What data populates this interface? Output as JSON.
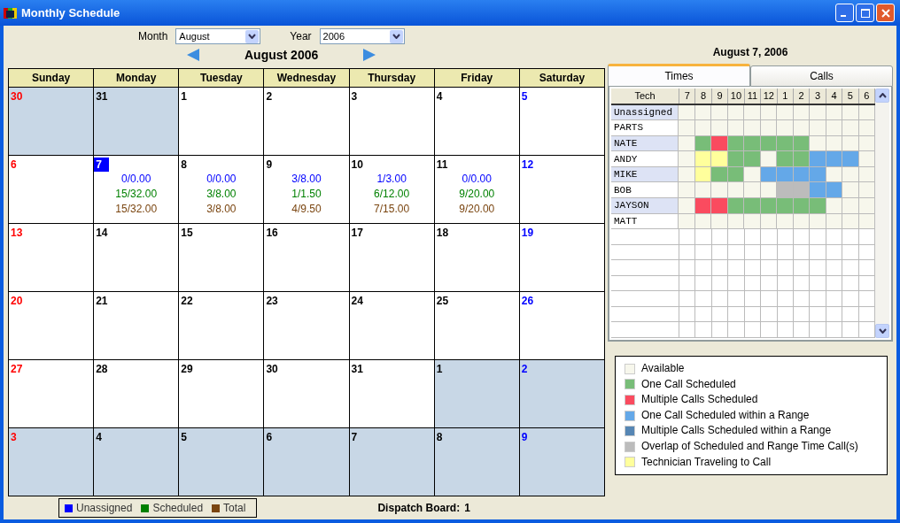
{
  "window": {
    "title": "Monthly Schedule"
  },
  "controls": {
    "month": {
      "label": "Month",
      "value": "August"
    },
    "year": {
      "label": "Year",
      "value": "2006"
    },
    "heading": "August 2006"
  },
  "calendar": {
    "weekdays": [
      "Sunday",
      "Monday",
      "Tuesday",
      "Wednesday",
      "Thursday",
      "Friday",
      "Saturday"
    ],
    "weeks": [
      [
        {
          "day": "30",
          "in_month": false,
          "selected": false
        },
        {
          "day": "31",
          "in_month": false,
          "selected": false
        },
        {
          "day": "1",
          "in_month": true,
          "selected": false
        },
        {
          "day": "2",
          "in_month": true,
          "selected": false
        },
        {
          "day": "3",
          "in_month": true,
          "selected": false
        },
        {
          "day": "4",
          "in_month": true,
          "selected": false
        },
        {
          "day": "5",
          "in_month": true,
          "selected": false
        }
      ],
      [
        {
          "day": "6",
          "in_month": true,
          "selected": false
        },
        {
          "day": "7",
          "in_month": true,
          "selected": true,
          "stats": [
            "0/0.00",
            "15/32.00",
            "15/32.00"
          ]
        },
        {
          "day": "8",
          "in_month": true,
          "selected": false,
          "stats": [
            "0/0.00",
            "3/8.00",
            "3/8.00"
          ]
        },
        {
          "day": "9",
          "in_month": true,
          "selected": false,
          "stats": [
            "3/8.00",
            "1/1.50",
            "4/9.50"
          ]
        },
        {
          "day": "10",
          "in_month": true,
          "selected": false,
          "stats": [
            "1/3.00",
            "6/12.00",
            "7/15.00"
          ]
        },
        {
          "day": "11",
          "in_month": true,
          "selected": false,
          "stats": [
            "0/0.00",
            "9/20.00",
            "9/20.00"
          ]
        },
        {
          "day": "12",
          "in_month": true,
          "selected": false
        }
      ],
      [
        {
          "day": "13",
          "in_month": true,
          "selected": false
        },
        {
          "day": "14",
          "in_month": true,
          "selected": false
        },
        {
          "day": "15",
          "in_month": true,
          "selected": false
        },
        {
          "day": "16",
          "in_month": true,
          "selected": false
        },
        {
          "day": "17",
          "in_month": true,
          "selected": false
        },
        {
          "day": "18",
          "in_month": true,
          "selected": false
        },
        {
          "day": "19",
          "in_month": true,
          "selected": false
        }
      ],
      [
        {
          "day": "20",
          "in_month": true,
          "selected": false
        },
        {
          "day": "21",
          "in_month": true,
          "selected": false
        },
        {
          "day": "22",
          "in_month": true,
          "selected": false
        },
        {
          "day": "23",
          "in_month": true,
          "selected": false
        },
        {
          "day": "24",
          "in_month": true,
          "selected": false
        },
        {
          "day": "25",
          "in_month": true,
          "selected": false
        },
        {
          "day": "26",
          "in_month": true,
          "selected": false
        }
      ],
      [
        {
          "day": "27",
          "in_month": true,
          "selected": false
        },
        {
          "day": "28",
          "in_month": true,
          "selected": false
        },
        {
          "day": "29",
          "in_month": true,
          "selected": false
        },
        {
          "day": "30",
          "in_month": true,
          "selected": false
        },
        {
          "day": "31",
          "in_month": true,
          "selected": false
        },
        {
          "day": "1",
          "in_month": false,
          "selected": false
        },
        {
          "day": "2",
          "in_month": false,
          "selected": false
        }
      ],
      [
        {
          "day": "3",
          "in_month": false,
          "selected": false
        },
        {
          "day": "4",
          "in_month": false,
          "selected": false
        },
        {
          "day": "5",
          "in_month": false,
          "selected": false
        },
        {
          "day": "6",
          "in_month": false,
          "selected": false
        },
        {
          "day": "7",
          "in_month": false,
          "selected": false
        },
        {
          "day": "8",
          "in_month": false,
          "selected": false
        },
        {
          "day": "9",
          "in_month": false,
          "selected": false
        }
      ]
    ]
  },
  "stats_legend": [
    {
      "label": "Unassigned",
      "color": "#0000ff"
    },
    {
      "label": "Scheduled",
      "color": "#008000"
    },
    {
      "label": "Total",
      "color": "#7a4510"
    }
  ],
  "dispatch_board": {
    "label": "Dispatch Board:",
    "value": "1"
  },
  "side_panel": {
    "date": "August 7, 2006",
    "tabs": [
      {
        "label": "Times",
        "selected": true
      },
      {
        "label": "Calls",
        "selected": false
      }
    ],
    "schedule": {
      "tech_header": "Tech",
      "hours": [
        "7",
        "8",
        "9",
        "10",
        "11",
        "12",
        "1",
        "2",
        "3",
        "4",
        "5",
        "6"
      ],
      "rows": [
        {
          "name": "Unassigned",
          "cells": [
            {
              "kind": "available"
            },
            {
              "kind": "available"
            },
            {
              "kind": "available"
            },
            {
              "kind": "available"
            },
            {
              "kind": "available"
            },
            {
              "kind": "available"
            },
            {
              "kind": "available"
            },
            {
              "kind": "available"
            },
            {
              "kind": "available"
            },
            {
              "kind": "available"
            },
            {
              "kind": "available"
            },
            {
              "kind": "available"
            }
          ]
        },
        {
          "name": "PARTS",
          "cells": [
            {
              "kind": "available"
            },
            {
              "kind": "available"
            },
            {
              "kind": "available"
            },
            {
              "kind": "available"
            },
            {
              "kind": "available"
            },
            {
              "kind": "available"
            },
            {
              "kind": "available"
            },
            {
              "kind": "available"
            },
            {
              "kind": "available"
            },
            {
              "kind": "available"
            },
            {
              "kind": "available"
            },
            {
              "kind": "available"
            }
          ]
        },
        {
          "name": "NATE",
          "cells": [
            {
              "kind": "available"
            },
            {
              "kind": "one"
            },
            {
              "kind": "multiple"
            },
            {
              "kind": "one"
            },
            {
              "kind": "one"
            },
            {
              "kind": "one"
            },
            {
              "kind": "one"
            },
            {
              "kind": "one"
            },
            {
              "kind": "available"
            },
            {
              "kind": "available"
            },
            {
              "kind": "available"
            },
            {
              "kind": "available"
            }
          ]
        },
        {
          "name": "ANDY",
          "cells": [
            {
              "kind": "available"
            },
            {
              "kind": "travel"
            },
            {
              "kind": "travel"
            },
            {
              "kind": "one"
            },
            {
              "kind": "one"
            },
            {
              "kind": "available"
            },
            {
              "kind": "one"
            },
            {
              "kind": "one"
            },
            {
              "kind": "range"
            },
            {
              "kind": "range"
            },
            {
              "kind": "range"
            },
            {
              "kind": "available"
            }
          ]
        },
        {
          "name": "MIKE",
          "cells": [
            {
              "kind": "available"
            },
            {
              "kind": "travel"
            },
            {
              "kind": "one"
            },
            {
              "kind": "one"
            },
            {
              "kind": "available"
            },
            {
              "kind": "range"
            },
            {
              "kind": "range"
            },
            {
              "kind": "range"
            },
            {
              "kind": "range"
            },
            {
              "kind": "available"
            },
            {
              "kind": "available"
            },
            {
              "kind": "available"
            }
          ]
        },
        {
          "name": "BOB",
          "cells": [
            {
              "kind": "available"
            },
            {
              "kind": "available"
            },
            {
              "kind": "available"
            },
            {
              "kind": "available"
            },
            {
              "kind": "available"
            },
            {
              "kind": "available"
            },
            {
              "kind": "overlap"
            },
            {
              "kind": "overlap"
            },
            {
              "kind": "range"
            },
            {
              "kind": "range"
            },
            {
              "kind": "available"
            },
            {
              "kind": "available"
            }
          ]
        },
        {
          "name": "JAYSON",
          "cells": [
            {
              "kind": "available"
            },
            {
              "kind": "multiple"
            },
            {
              "kind": "multiple"
            },
            {
              "kind": "one"
            },
            {
              "kind": "one"
            },
            {
              "kind": "one"
            },
            {
              "kind": "one"
            },
            {
              "kind": "one"
            },
            {
              "kind": "one"
            },
            {
              "kind": "available"
            },
            {
              "kind": "available"
            },
            {
              "kind": "available"
            }
          ]
        },
        {
          "name": "MATT",
          "cells": [
            {
              "kind": "available"
            },
            {
              "kind": "available"
            },
            {
              "kind": "available"
            },
            {
              "kind": "available"
            },
            {
              "kind": "available"
            },
            {
              "kind": "available"
            },
            {
              "kind": "available"
            },
            {
              "kind": "available"
            },
            {
              "kind": "available"
            },
            {
              "kind": "available"
            },
            {
              "kind": "available"
            },
            {
              "kind": "available"
            }
          ]
        }
      ]
    },
    "legend": [
      {
        "kind": "available",
        "label": "Available",
        "color": "#f7f7ec"
      },
      {
        "kind": "one",
        "label": "One Call Scheduled",
        "color": "#78bd78"
      },
      {
        "kind": "multiple",
        "label": "Multiple Calls Scheduled",
        "color": "#fa4b5f"
      },
      {
        "kind": "range",
        "label": "One Call Scheduled within a Range",
        "color": "#64a8e8"
      },
      {
        "kind": "multiple_range",
        "label": "Multiple Calls Scheduled within a Range",
        "color": "#5686b4"
      },
      {
        "kind": "overlap",
        "label": "Overlap of Scheduled and Range Time Call(s)",
        "color": "#bcbcbc"
      },
      {
        "kind": "travel",
        "label": "Technician Traveling to Call",
        "color": "#ffff9c"
      }
    ]
  }
}
